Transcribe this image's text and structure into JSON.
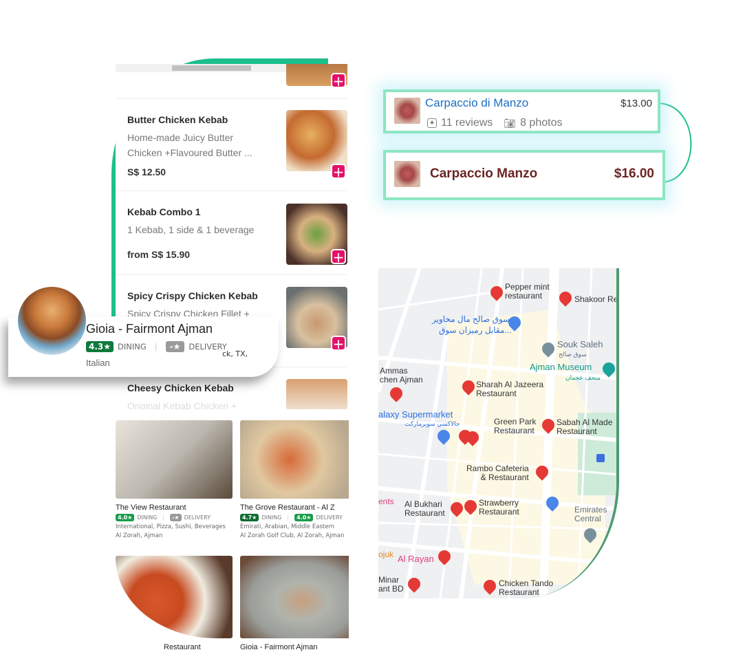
{
  "menu": {
    "items": [
      {
        "title": "Butter Chicken Kebab",
        "desc1": "Home-made Juicy Butter",
        "desc2": "Chicken +Flavoured Butter ...",
        "price": "S$ 12.50"
      },
      {
        "title": "Kebab Combo 1",
        "desc1": "1 Kebab, 1 side & 1 beverage",
        "price": "from S$ 15.90"
      },
      {
        "title": "Spicy Crispy Chicken Kebab",
        "desc1": "Spicy Crispy Chicken Fillet +"
      },
      {
        "title": "Cheesy Chicken Kebab",
        "desc1": "Original Kebab Chicken +"
      }
    ],
    "add_label": "+"
  },
  "featured": {
    "name": "Gioia - Fairmont Ajman",
    "dining_rating": "4.3★",
    "dining_label": "DINING",
    "delivery_rating": "-★",
    "delivery_label": "DELIVERY",
    "cuisine": "Italian",
    "overflow_text": "ck, TX,"
  },
  "restaurants": [
    {
      "name": "The View Restaurant",
      "dining": "4.0★",
      "delivery": "-★",
      "cuisine": "International, Pizza, Sushi, Beverages",
      "location": "Al Zorah, Ajman"
    },
    {
      "name": "The Grove Restaurant - Al Z",
      "dining": "4.7★",
      "delivery": "4.0★",
      "cuisine": "Emirati, Arabian, Middle Eastern",
      "location": "Al Zorah Golf Club, Al Zorah, Ajman"
    },
    {
      "name": "Restaurant"
    },
    {
      "name": "Gioia - Fairmont Ajman"
    }
  ],
  "labels": {
    "dining": "DINING",
    "delivery": "DELIVERY"
  },
  "comparison": {
    "a": {
      "name": "Carpaccio di Manzo",
      "price": "$13.00",
      "reviews": "11 reviews",
      "photos": "8 photos"
    },
    "b": {
      "name": "Carpaccio Manzo",
      "price": "$16.00"
    }
  },
  "map": {
    "labels": [
      "Pepper mint\nrestaurant",
      "Shakoor Re",
      "سوق صالح مال مخاوير",
      "مقابل رميزان سوق...",
      "Souk Saleh",
      "سوق صالح",
      "Ajman Museum",
      "متحف عجمان",
      "Ammas\nchen Ajman",
      "Sharah Al Jazeera\nRestaurant",
      "alaxy Supermarket",
      "جالاكسي سوبرماركت",
      "Green Park\nRestaurant",
      "Sabah Al Made\nRestaurant",
      "Rambo Cafeteria\n& Restaurant",
      "ents",
      "Al Bukhari\nRestaurant",
      "Strawberry\nRestaurant",
      "Emirates\nCentral",
      "ojuk",
      "Al Rayan",
      "Minar\nant BD",
      "Chicken Tando\nRestaurant"
    ]
  },
  "colors": {
    "accent_green": "#1cbf8c",
    "add_pink": "#e5106a",
    "rating_green": "#1a9c4a",
    "rating_dark": "#0e6b32",
    "box_border": "#8de6c2",
    "link_blue": "#1a6fc2",
    "price_maroon": "#6b2424",
    "pin_red": "#e53935"
  }
}
